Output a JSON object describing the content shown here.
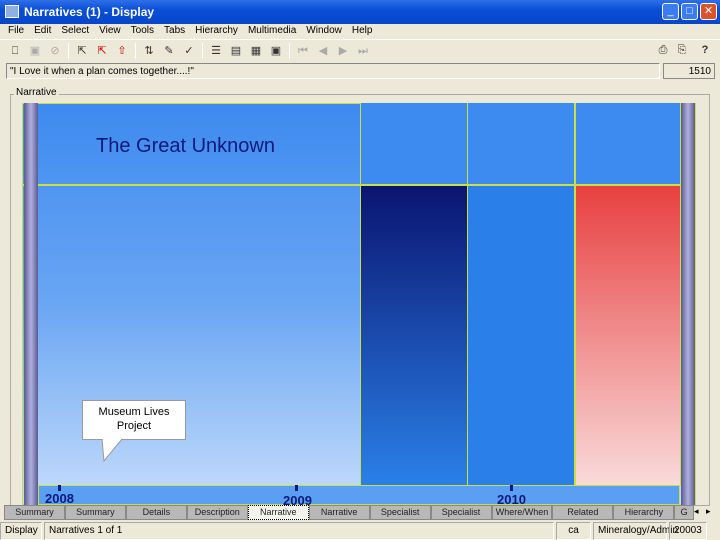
{
  "window": {
    "title": "Narratives (1) - Display"
  },
  "menu": [
    "File",
    "Edit",
    "Select",
    "View",
    "Tools",
    "Tabs",
    "Hierarchy",
    "Multimedia",
    "Window",
    "Help"
  ],
  "quote_field": {
    "value": "\"I Love it when a plan comes together....!\""
  },
  "record_count": "1510",
  "group_label": "Narrative",
  "narrative": {
    "title": "The Great Unknown",
    "callout": "Museum Lives Project",
    "years": [
      "2008",
      "2009",
      "2010"
    ]
  },
  "tabs": [
    "Summary",
    "Summary",
    "Details",
    "Description",
    "Narrative",
    "Narrative",
    "Specialist",
    "Specialist",
    "Where/When",
    "Related",
    "Hierarchy",
    "G"
  ],
  "selected_tab": 4,
  "status": {
    "mode": "Display",
    "position": "Narratives 1 of 1",
    "lang": "ca",
    "user": "Mineralogy/Admin",
    "id": "20003"
  }
}
